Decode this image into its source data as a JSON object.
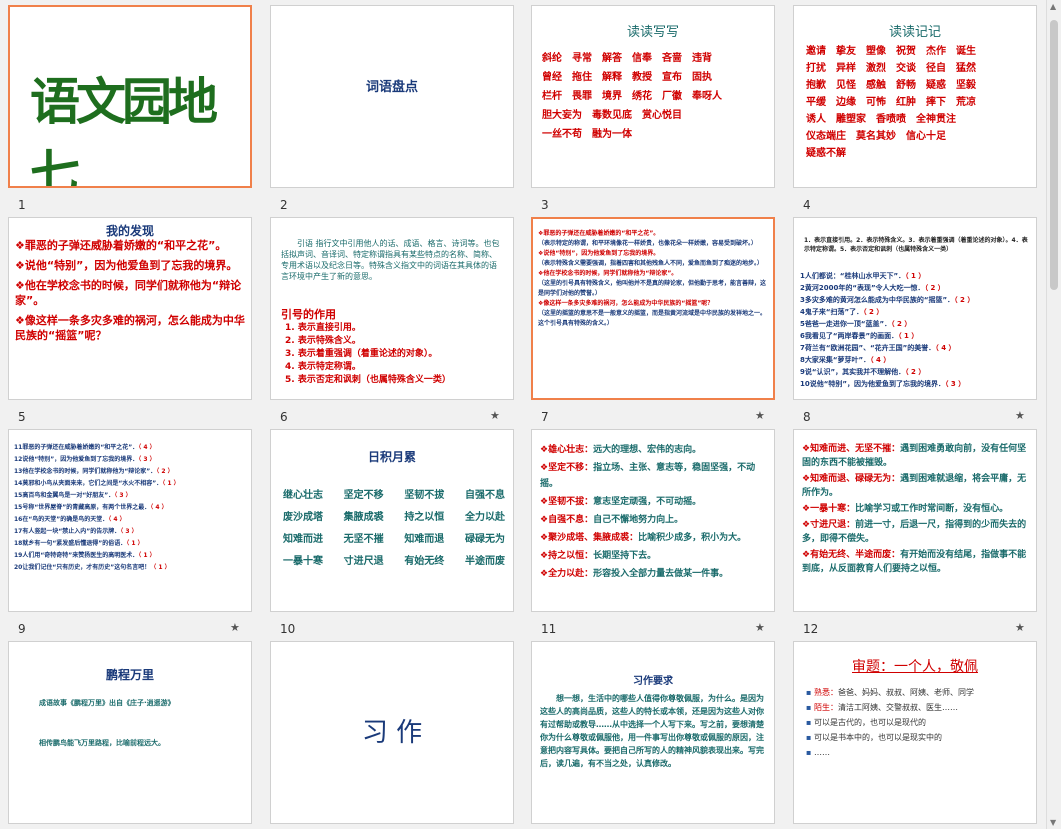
{
  "slides": {
    "s1": {
      "num": "1",
      "title": "语文园地七"
    },
    "s2": {
      "num": "2",
      "title": "词语盘点"
    },
    "s3": {
      "num": "3",
      "title": "读读写写",
      "lines": [
        "斜纶　寻常　解答　信奉　吝啬　违背",
        "曾经　拖住　解释　教授　宣布　固执",
        "栏杆　畏罪　境界　绣花　厂徽　奉呀人",
        "胆大妄为　毒数见底　赏心悦目",
        "一丝不苟　融为一体"
      ]
    },
    "s4": {
      "num": "4",
      "title": "读读记记",
      "lines": [
        "邀请　挚友　塑像　祝贺　杰作　诞生",
        "打扰　异样　激烈　交谈　径自　猛然",
        "抱歉　见怪　感触　舒畅　疑惑　坚毅",
        "平缓　边缘　可怖　红肿　摔下　荒凉",
        "诱人　雕塑家　香喷喷　全神贯注",
        "仪态端庄　莫名其妙　信心十足",
        "疑惑不解"
      ]
    },
    "s5": {
      "num": "5",
      "title": "我的发现",
      "items": [
        "罪恶的子弹还威胁着娇嫩的“和平之花”。",
        "说他“特别”，因为他爱鱼到了忘我的境界。",
        "他在学校念书的时候，同学们就称他为“辩论家”。",
        "像这样一条多灾多难的祸河，怎么能成为中华民族的“摇篮”呢？"
      ]
    },
    "s6": {
      "num": "6",
      "para": "引语 指行文中引用他人的话、成语、格言、诗词等。也包括拟声词、音译词、特定称谓指具有某些特点的名称、简称、专用术语以及纪念日等。特殊含义指文中的词语在其具体的语言环境中产生了新的意思。",
      "subtitle": "引号的作用",
      "uses": [
        "1. 表示直接引用。",
        "2. 表示特殊含义。",
        "3. 表示着重强调（着重论述的对象）。",
        "4. 表示特定称谓。",
        "5. 表示否定和讽刺（也属特殊含义一类）"
      ]
    },
    "s7": {
      "num": "7",
      "lines": [
        "罪恶的子弹还在威胁着娇嫩的“和平之花”。",
        "（表示特定的称谓，和平环境像花一样娇贵，也像花朵一样娇嫩，容易受到破坏。）",
        "说他“特别”，因为他爱鱼到了忘我的境界。",
        "（表示特殊含义需要强调，指着四害和其他残鱼人不同，爱鱼而鱼到了痴迷的地步。）",
        "他在学校念书的时候，同学们就称他为“辩论家”。",
        "（这里的引号具有特殊含义，他叫他并不是真的辩论家，但他勤于思考，能言善辩，这是同学们对他的赞誉。）",
        "像这样一条多灾多难的祸河，怎么能成为中华民族的“摇篮”呢？",
        "（这里的摇篮的意思不是一般意义的摇篮，而是指黄河流域是中华民族的发祥地之一。这个引号具有特殊的含义。）"
      ]
    },
    "s8": {
      "num": "8",
      "header": "1．表示直接引用。2．表示特殊含义。3．表示着重强调（着重论述的对象）。4．表示特定称谓。5．表示否定和讽刺（也属特殊含义一类）",
      "items": [
        {
          "t": "1人们都说：“桂林山水甲天下”．",
          "a": "（ 1 ）"
        },
        {
          "t": "2黄河2000年的“表现”令人大吃一惊．",
          "a": "（ 2 ）"
        },
        {
          "t": "3多灾多难的黄河怎么能成为中华民族的“摇篮”．",
          "a": "（ 2 ）"
        },
        {
          "t": "4鬼子来“扫荡”了．",
          "a": "（ 2 ）"
        },
        {
          "t": "5爸爸一走进你一顶“蓝盖”．",
          "a": "（ 2 ）"
        },
        {
          "t": "6我看见了“两岸春景”的画面．",
          "a": "（ 1 ）"
        },
        {
          "t": "7荷兰有“欧洲花园”、“花卉王国”的美誉．",
          "a": "（ 4 ）"
        },
        {
          "t": "8大家采集“萝芽叶”．",
          "a": "（ 4 ）"
        },
        {
          "t": "9说“认识”，其实我并不理解他．",
          "a": "（ 2 ）"
        },
        {
          "t": "10说他“特别”，因为他爱鱼到了忘我的境界．",
          "a": "（ 3 ）"
        }
      ]
    },
    "s9": {
      "num": "9",
      "items": [
        {
          "t": "11罪恶的子弹还在威胁着娇嫩的“和平之花”．",
          "a": "（ 4 ）"
        },
        {
          "t": "12说他“特别”，因为他爱鱼到了忘我的境界．",
          "a": "（ 3 ）"
        },
        {
          "t": "13他在学校念书的时候，同学们就称他为“辩论家”．",
          "a": "（ 2 ）"
        },
        {
          "t": "14莫邪和小鸟从夹面来来，它们之间是“水火不相容”．",
          "a": "（ 1 ）"
        },
        {
          "t": "15高百鸟和金翼鸟是一对“好朋友”．",
          "a": "（ 3 ）"
        },
        {
          "t": "15号称“世界屋脊”的青藏高原，有两个世界之最．",
          "a": "（ 4 ）"
        },
        {
          "t": "16在“鸟的天堂”的确是鸟的天堂．",
          "a": "（ 4 ）"
        },
        {
          "t": "17有人竖起一块“禁止入内”的告示牌．",
          "a": "（ 3 ）"
        },
        {
          "t": "18就乡有一句“紧发盛后懂退得”的俗语．",
          "a": "（ 1 ）"
        },
        {
          "t": "19人们用“奇特奇特”来赞扬医生的高明医术．",
          "a": "（ 1 ）"
        },
        {
          "t": "20让我们记住“只有历史，才有历史”这句名言吧！",
          "a": "（ 1 ）"
        }
      ]
    },
    "s10": {
      "num": "10",
      "title": "日积月累",
      "rows": [
        [
          "继心壮志",
          "坚定不移",
          "坚韧不拔",
          "自强不息"
        ],
        [
          "废沙成塔",
          "集腋成裘",
          "持之以恒",
          "全力以赴"
        ],
        [
          "知难而进",
          "无坚不摧",
          "知难而退",
          "碌碌无为"
        ],
        [
          "一暴十寒",
          "寸进尺退",
          "有始无终",
          "半途而废"
        ]
      ]
    },
    "s11": {
      "num": "11",
      "items": [
        {
          "k": "雄心壮志：",
          "v": "远大的理想、宏伟的志向。"
        },
        {
          "k": "坚定不移：",
          "v": "指立场、主张、意志等，稳固坚强，不动摇。"
        },
        {
          "k": "坚韧不拔：",
          "v": "意志坚定顽强，不可动摇。"
        },
        {
          "k": "自强不息：",
          "v": "自己不懈地努力向上。"
        },
        {
          "k": "聚沙成塔、集腋成裘：",
          "v": "比喻积少成多，积小为大。"
        },
        {
          "k": "持之以恒：",
          "v": "长期坚持下去。"
        },
        {
          "k": "全力以赴：",
          "v": "形容投入全部力量去做某一件事。"
        }
      ]
    },
    "s12": {
      "num": "12",
      "items": [
        {
          "k": "知难而进、无坚不摧：",
          "v": "遇到困难勇敢向前，没有任何坚固的东西不能被摧毁。"
        },
        {
          "k": "知难而退、碌碌无为：",
          "v": "遇到困难就退缩，将会平庸，无所作为。"
        },
        {
          "k": "一暴十寒：",
          "v": "比喻学习或工作时常间断，没有恒心。"
        },
        {
          "k": "寸进尺退：",
          "v": "前进一寸，后退一尺，指得到的少而失去的多，即得不偿失。"
        },
        {
          "k": "有始无终、半途而废：",
          "v": "有开始而没有结尾，指做事不能到底，从反面教育人们要持之以恒。"
        }
      ]
    },
    "s13": {
      "title": "鹏程万里",
      "line1": "成语故事《鹏程万里》出自《庄子·逍遥游》",
      "line2": "相传鹏鸟能飞万里路程，比喻前程远大。"
    },
    "s14": {
      "title": "习 作"
    },
    "s15": {
      "title": "习作要求",
      "para": "想一想，生活中的哪些人值得你尊敬佩服，为什么。是因为这些人的高尚品质，这些人的特长或本领，还是因为这些人对你有过帮助或教导……从中选择一个人写下来。写之前，要想清楚你为什么尊敬或佩服他，用一件事写出你尊敬或佩服的原因，注意把内容写具体。要把自己所写的人的精神风貌表现出来。写完后，读几遍，有不当之处，认真修改。"
    },
    "s16": {
      "title": "审题：一个人，敬佩",
      "items": [
        {
          "k": "熟悉：",
          "v": "爸爸、妈妈、叔叔、阿姨、老师、同学"
        },
        {
          "k": "陌生：",
          "v": "清洁工阿姨、交警叔叔、医生……"
        },
        {
          "k": "",
          "v": "可以是古代的，也可以是现代的"
        },
        {
          "k": "",
          "v": "可以是书本中的，也可以是现实中的"
        },
        {
          "k": "",
          "v": "……"
        }
      ]
    }
  },
  "colors": {
    "accent_selection": "#f0804a",
    "title_green": "#1e6e1e",
    "red": "#d00000",
    "teal": "#1a6b6b",
    "navy": "#1a3a7a"
  }
}
